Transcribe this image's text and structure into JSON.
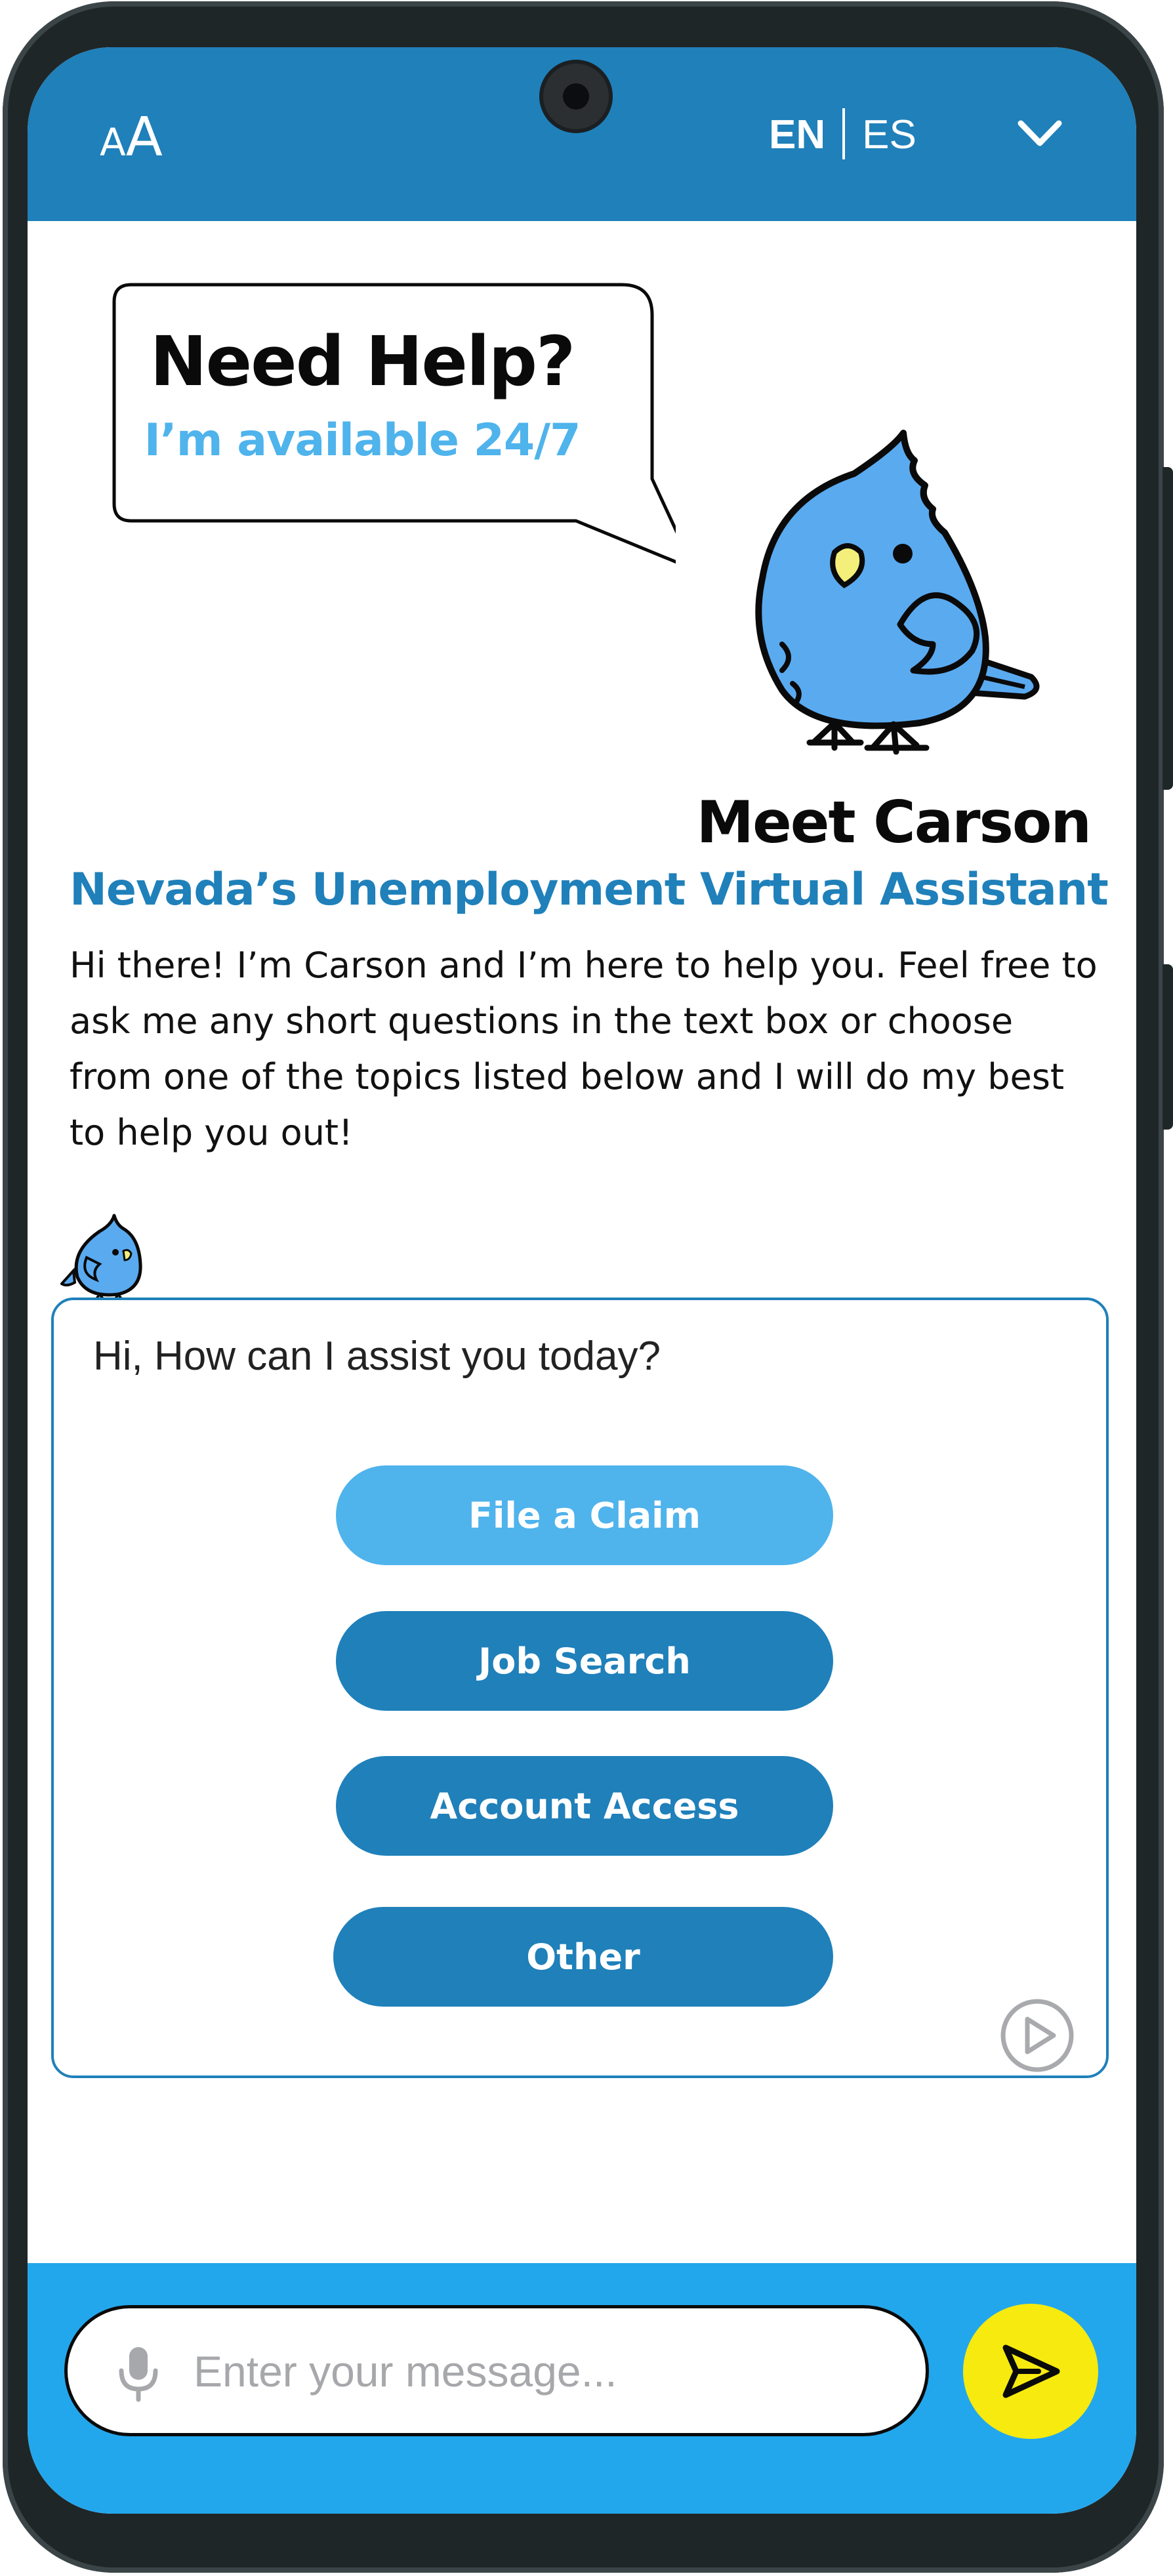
{
  "header": {
    "font_toggle_small": "A",
    "font_toggle_large": "A",
    "lang_en": "EN",
    "lang_es": "ES",
    "menu_icon": "chevron-down-icon"
  },
  "hero": {
    "bubble_title": "Need Help?",
    "bubble_subtitle": "I’m available 24/7",
    "mascot_icon": "bird-mascot",
    "meet_title": "Meet Carson",
    "subtitle": "Nevada’s Unemployment Virtual Assistant",
    "intro": "Hi there! I’m Carson and I’m here to help you.  Feel free to ask me any short questions in the text box or choose from one of the topics listed below and I will do my best to help you out!"
  },
  "chat": {
    "avatar_icon": "bird-avatar",
    "greeting": "Hi, How can I assist you today?",
    "options": [
      {
        "label": "File a Claim"
      },
      {
        "label": "Job Search"
      },
      {
        "label": "Account Access"
      },
      {
        "label": "Other"
      }
    ],
    "play_icon": "play-icon"
  },
  "composer": {
    "mic_icon": "microphone-icon",
    "placeholder": "Enter your message...",
    "value": "",
    "send_icon": "send-icon"
  },
  "colors": {
    "primary": "#1f80ba",
    "accent_light": "#4fb3ec",
    "bottom_bar": "#23a7ec",
    "send_button": "#f6ea0f",
    "mascot": "#5aaaf0"
  }
}
